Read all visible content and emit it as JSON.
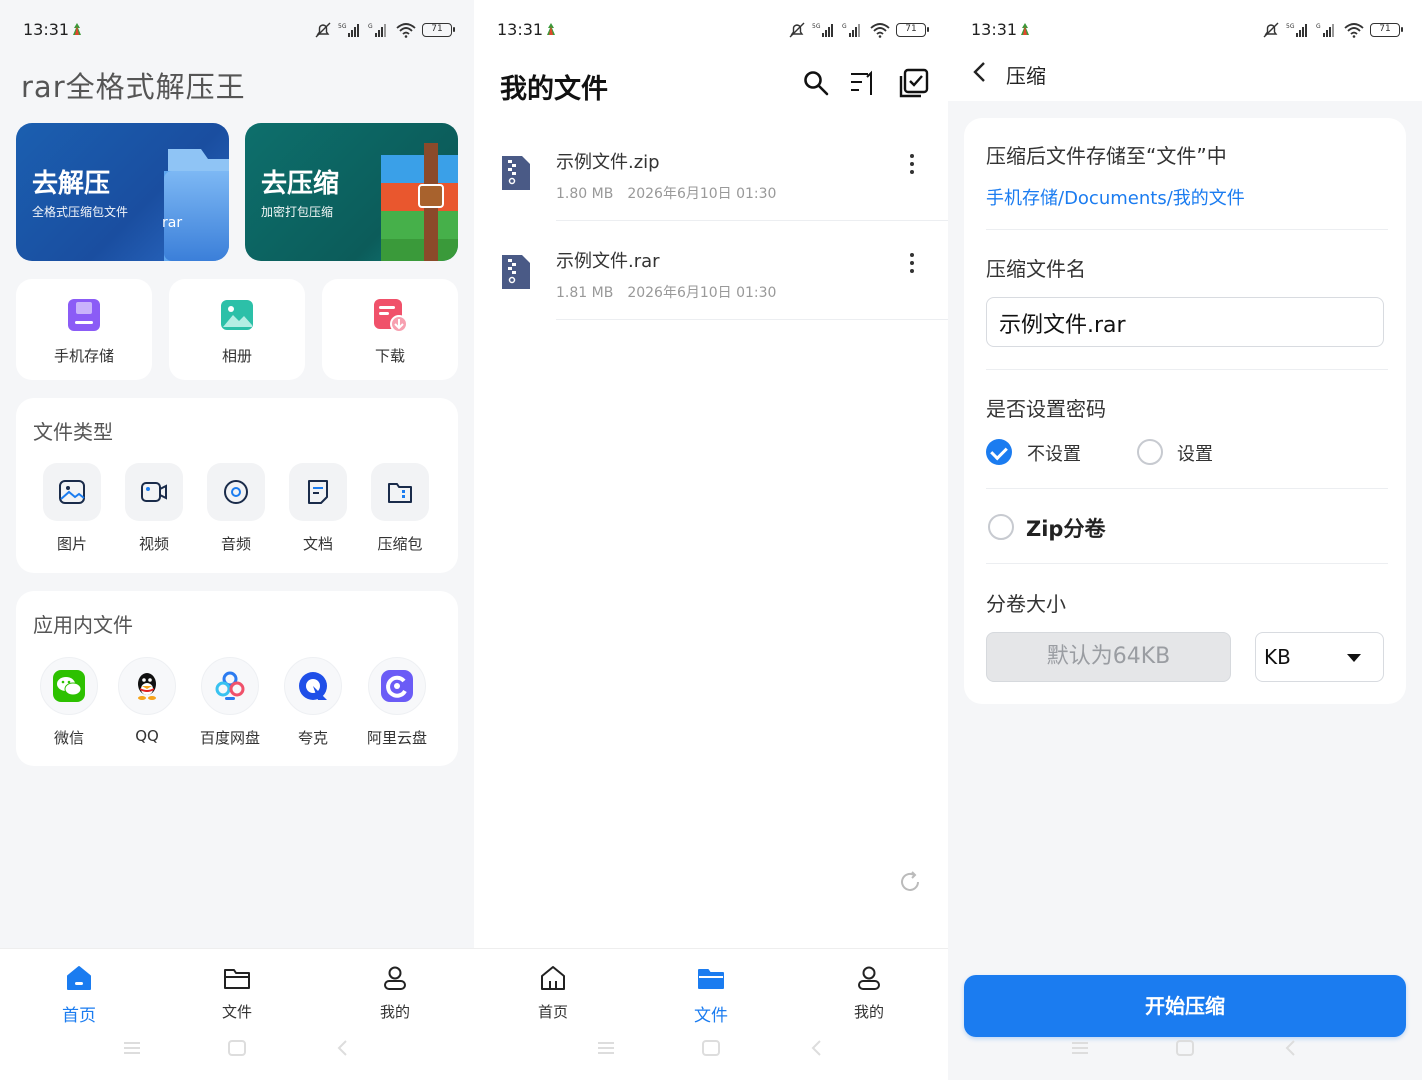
{
  "status": {
    "time": "13:31",
    "battery": "71",
    "network": "5G"
  },
  "home": {
    "title": "rar全格式解压王",
    "hero": [
      {
        "title": "去解压",
        "subtitle": "全格式压缩包文件",
        "badge": "rar"
      },
      {
        "title": "去压缩",
        "subtitle": "加密打包压缩"
      }
    ],
    "quick": [
      {
        "label": "手机存储",
        "icon": "phone-storage-icon",
        "color": "#8b5cf6"
      },
      {
        "label": "相册",
        "icon": "album-icon",
        "color": "#2cc0a8"
      },
      {
        "label": "下载",
        "icon": "download-icon",
        "color": "#f0516a"
      }
    ],
    "file_types": {
      "title": "文件类型",
      "items": [
        {
          "label": "图片",
          "icon": "image-icon"
        },
        {
          "label": "视频",
          "icon": "video-icon"
        },
        {
          "label": "音频",
          "icon": "audio-icon"
        },
        {
          "label": "文档",
          "icon": "document-icon"
        },
        {
          "label": "压缩包",
          "icon": "archive-icon"
        }
      ]
    },
    "app_files": {
      "title": "应用内文件",
      "items": [
        {
          "label": "微信",
          "icon": "wechat-icon"
        },
        {
          "label": "QQ",
          "icon": "qq-icon"
        },
        {
          "label": "百度网盘",
          "icon": "baidu-netdisk-icon"
        },
        {
          "label": "夸克",
          "icon": "quark-icon"
        },
        {
          "label": "阿里云盘",
          "icon": "aliyun-drive-icon"
        }
      ]
    }
  },
  "tabs": [
    {
      "label": "首页",
      "icon": "home-icon"
    },
    {
      "label": "文件",
      "icon": "folder-icon"
    },
    {
      "label": "我的",
      "icon": "user-icon"
    }
  ],
  "files": {
    "title": "我的文件",
    "items": [
      {
        "name": "示例文件.zip",
        "size": "1.80 MB",
        "date": "2026年6月10日 01:30"
      },
      {
        "name": "示例文件.rar",
        "size": "1.81 MB",
        "date": "2026年6月10日 01:30"
      }
    ]
  },
  "compress": {
    "title": "压缩",
    "storage_label": "压缩后文件存储至“文件”中",
    "storage_path": "手机存储/Documents/我的文件",
    "name_label": "压缩文件名",
    "name_value": "示例文件.rar",
    "password_label": "是否设置密码",
    "password_options": [
      "不设置",
      "设置"
    ],
    "password_selected": "不设置",
    "zip_split_label": "Zip分卷",
    "zip_split_checked": false,
    "volume_size_label": "分卷大小",
    "volume_size_placeholder": "默认为64KB",
    "unit": "KB",
    "start_button": "开始压缩"
  },
  "colors": {
    "accent": "#1b7cf0"
  }
}
